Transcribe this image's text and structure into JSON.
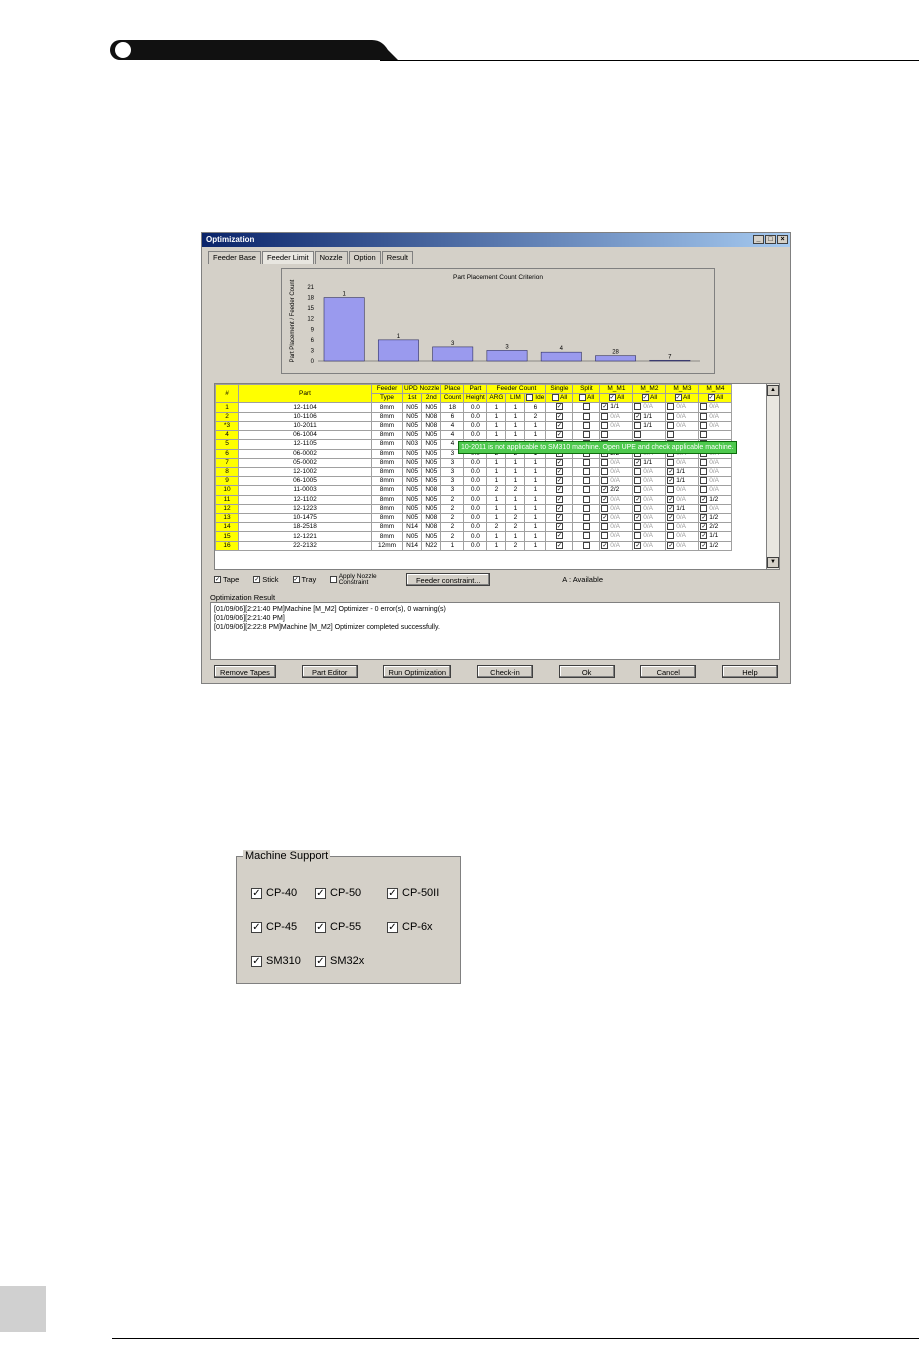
{
  "window": {
    "title": "Optimization",
    "tabs": [
      "Feeder Base",
      "Feeder Limit",
      "Nozzle",
      "Option",
      "Result"
    ],
    "active_tab": "Feeder Limit"
  },
  "chart_data": {
    "type": "bar",
    "title": "Part Placement Count Criterion",
    "ylabel": "Part Placement / Feeder Count",
    "yticks": [
      0,
      3,
      6,
      9,
      12,
      15,
      18,
      21
    ],
    "ylim": [
      0,
      21
    ],
    "values": [
      18,
      6,
      4,
      3,
      2.5,
      1.5,
      0.2
    ],
    "data_labels": [
      "1",
      "1",
      "3",
      "3",
      "4",
      "28",
      "7"
    ]
  },
  "grid": {
    "headers_top": [
      "#",
      "Part",
      "Feeder",
      "UPD Nozzle",
      "Place",
      "Part",
      "Feeder Count",
      "Single",
      "Split",
      "M_M1",
      "M_M2",
      "M_M3",
      "M_M4"
    ],
    "headers_sub": [
      "Type",
      "1st",
      "2nd",
      "Count",
      "Height",
      "ARG",
      "LIM",
      "Ide",
      "All",
      "All",
      "All",
      "All",
      "All",
      "All"
    ],
    "rows": [
      {
        "n": "1",
        "part": "12-1104",
        "type": "8mm",
        "n1": "N05",
        "n2": "N05",
        "count": "18",
        "h": "0.0",
        "arg": "1",
        "lim": "1",
        "ide": "6",
        "m1": "1/1",
        "m2": "0/A",
        "m3": "0/A",
        "m4": "0/A",
        "c1": true,
        "c2": false,
        "c3": false,
        "c4": false
      },
      {
        "n": "2",
        "part": "10-1106",
        "type": "8mm",
        "n1": "N05",
        "n2": "N08",
        "count": "6",
        "h": "0.0",
        "arg": "1",
        "lim": "1",
        "ide": "2",
        "m1": "0/A",
        "m2": "1/1",
        "m3": "0/A",
        "m4": "0/A",
        "c1": false,
        "c2": true,
        "c3": false,
        "c4": false
      },
      {
        "n": "*3",
        "part": "10-2011",
        "type": "8mm",
        "n1": "N05",
        "n2": "N08",
        "count": "4",
        "h": "0.0",
        "arg": "1",
        "lim": "1",
        "ide": "1",
        "m1": "0/A",
        "m2": "1/1",
        "m3": "0/A",
        "m4": "0/A",
        "c1": false,
        "c2": false,
        "c3": false,
        "c4": false
      },
      {
        "n": "4",
        "part": "06-1004",
        "type": "8mm",
        "n1": "N05",
        "n2": "N05",
        "count": "4",
        "h": "0.0",
        "arg": "1",
        "lim": "1",
        "ide": "1",
        "m1": "",
        "m2": "",
        "m3": "",
        "m4": "",
        "c1": false,
        "c2": false,
        "c3": false,
        "c4": false
      },
      {
        "n": "5",
        "part": "12-1105",
        "type": "8mm",
        "n1": "N03",
        "n2": "N05",
        "count": "4",
        "h": "0.0",
        "arg": "1",
        "lim": "1",
        "ide": "1",
        "m1": "",
        "m2": "",
        "m3": "",
        "m4": "",
        "c1": false,
        "c2": false,
        "c3": false,
        "c4": false
      },
      {
        "n": "6",
        "part": "06-0002",
        "type": "8mm",
        "n1": "N05",
        "n2": "N05",
        "count": "3",
        "h": "0.0",
        "arg": "2",
        "lim": "2",
        "ide": "1",
        "m1": "2/2",
        "m2": "0/A",
        "m3": "0/A",
        "m4": "0/A",
        "c1": true,
        "c2": false,
        "c3": false,
        "c4": false
      },
      {
        "n": "7",
        "part": "05-0002",
        "type": "8mm",
        "n1": "N05",
        "n2": "N05",
        "count": "3",
        "h": "0.0",
        "arg": "1",
        "lim": "1",
        "ide": "1",
        "m1": "0/A",
        "m2": "1/1",
        "m3": "0/A",
        "m4": "0/A",
        "c1": false,
        "c2": true,
        "c3": false,
        "c4": false
      },
      {
        "n": "8",
        "part": "12-1002",
        "type": "8mm",
        "n1": "N05",
        "n2": "N05",
        "count": "3",
        "h": "0.0",
        "arg": "1",
        "lim": "1",
        "ide": "1",
        "m1": "0/A",
        "m2": "0/A",
        "m3": "1/1",
        "m4": "0/A",
        "c1": false,
        "c2": false,
        "c3": true,
        "c4": false
      },
      {
        "n": "9",
        "part": "06-1005",
        "type": "8mm",
        "n1": "N05",
        "n2": "N05",
        "count": "3",
        "h": "0.0",
        "arg": "1",
        "lim": "1",
        "ide": "1",
        "m1": "0/A",
        "m2": "0/A",
        "m3": "1/1",
        "m4": "0/A",
        "c1": false,
        "c2": false,
        "c3": true,
        "c4": false
      },
      {
        "n": "10",
        "part": "11-0003",
        "type": "8mm",
        "n1": "N05",
        "n2": "N08",
        "count": "3",
        "h": "0.0",
        "arg": "2",
        "lim": "2",
        "ide": "1",
        "m1": "2/2",
        "m2": "0/A",
        "m3": "0/A",
        "m4": "0/A",
        "c1": true,
        "c2": false,
        "c3": false,
        "c4": false
      },
      {
        "n": "11",
        "part": "12-1102",
        "type": "8mm",
        "n1": "N05",
        "n2": "N05",
        "count": "2",
        "h": "0.0",
        "arg": "1",
        "lim": "1",
        "ide": "1",
        "m1": "0/A",
        "m2": "0/A",
        "m3": "0/A",
        "m4": "1/2",
        "c1": true,
        "c2": true,
        "c3": true,
        "c4": true
      },
      {
        "n": "12",
        "part": "12-1223",
        "type": "8mm",
        "n1": "N05",
        "n2": "N05",
        "count": "2",
        "h": "0.0",
        "arg": "1",
        "lim": "1",
        "ide": "1",
        "m1": "0/A",
        "m2": "0/A",
        "m3": "1/1",
        "m4": "0/A",
        "c1": false,
        "c2": false,
        "c3": true,
        "c4": false
      },
      {
        "n": "13",
        "part": "10-1475",
        "type": "8mm",
        "n1": "N05",
        "n2": "N08",
        "count": "2",
        "h": "0.0",
        "arg": "1",
        "lim": "2",
        "ide": "1",
        "m1": "0/A",
        "m2": "0/A",
        "m3": "0/A",
        "m4": "1/2",
        "c1": true,
        "c2": true,
        "c3": true,
        "c4": true
      },
      {
        "n": "14",
        "part": "18-2518",
        "type": "8mm",
        "n1": "N14",
        "n2": "N08",
        "count": "2",
        "h": "0.0",
        "arg": "2",
        "lim": "2",
        "ide": "1",
        "m1": "0/A",
        "m2": "0/A",
        "m3": "0/A",
        "m4": "2/2",
        "c1": false,
        "c2": false,
        "c3": false,
        "c4": true
      },
      {
        "n": "15",
        "part": "12-1221",
        "type": "8mm",
        "n1": "N05",
        "n2": "N05",
        "count": "2",
        "h": "0.0",
        "arg": "1",
        "lim": "1",
        "ide": "1",
        "m1": "0/A",
        "m2": "0/A",
        "m3": "0/A",
        "m4": "1/1",
        "c1": false,
        "c2": false,
        "c3": false,
        "c4": true
      },
      {
        "n": "16",
        "part": "22-2132",
        "type": "12mm",
        "n1": "N14",
        "n2": "N22",
        "count": "1",
        "h": "0.0",
        "arg": "1",
        "lim": "2",
        "ide": "1",
        "m1": "0/A",
        "m2": "0/A",
        "m3": "0/A",
        "m4": "1/2",
        "c1": true,
        "c2": true,
        "c3": true,
        "c4": true
      }
    ]
  },
  "tooltip": "10-2011 is not applicable to SM310 machine. Open UPE and check applicable machine.",
  "options": {
    "tape": "Tape",
    "stick": "Stick",
    "tray": "Tray",
    "nozzle": "Apply Nozzle Constraint",
    "feeder_btn": "Feeder constraint...",
    "legend": "A : Available"
  },
  "result": {
    "label": "Optimization Result",
    "lines": [
      "[01/09/06][2:21:40 PM]Machine [M_M2] Optimizer - 0 error(s), 0 warning(s)",
      "[01/09/06][2:21:40 PM]",
      "[01/09/06][2:22:8 PM]Machine [M_M2] Optimizer completed successfully."
    ]
  },
  "buttons": {
    "remove_tapes": "Remove Tapes",
    "part_editor": "Part Editor",
    "run": "Run Optimization",
    "checkin": "Check-in",
    "ok": "Ok",
    "cancel": "Cancel",
    "help": "Help"
  },
  "machine_support": {
    "title": "Machine Support",
    "items": [
      "CP-40",
      "CP-50",
      "CP-50II",
      "CP-45",
      "CP-55",
      "CP-6x",
      "SM310",
      "SM32x"
    ]
  }
}
